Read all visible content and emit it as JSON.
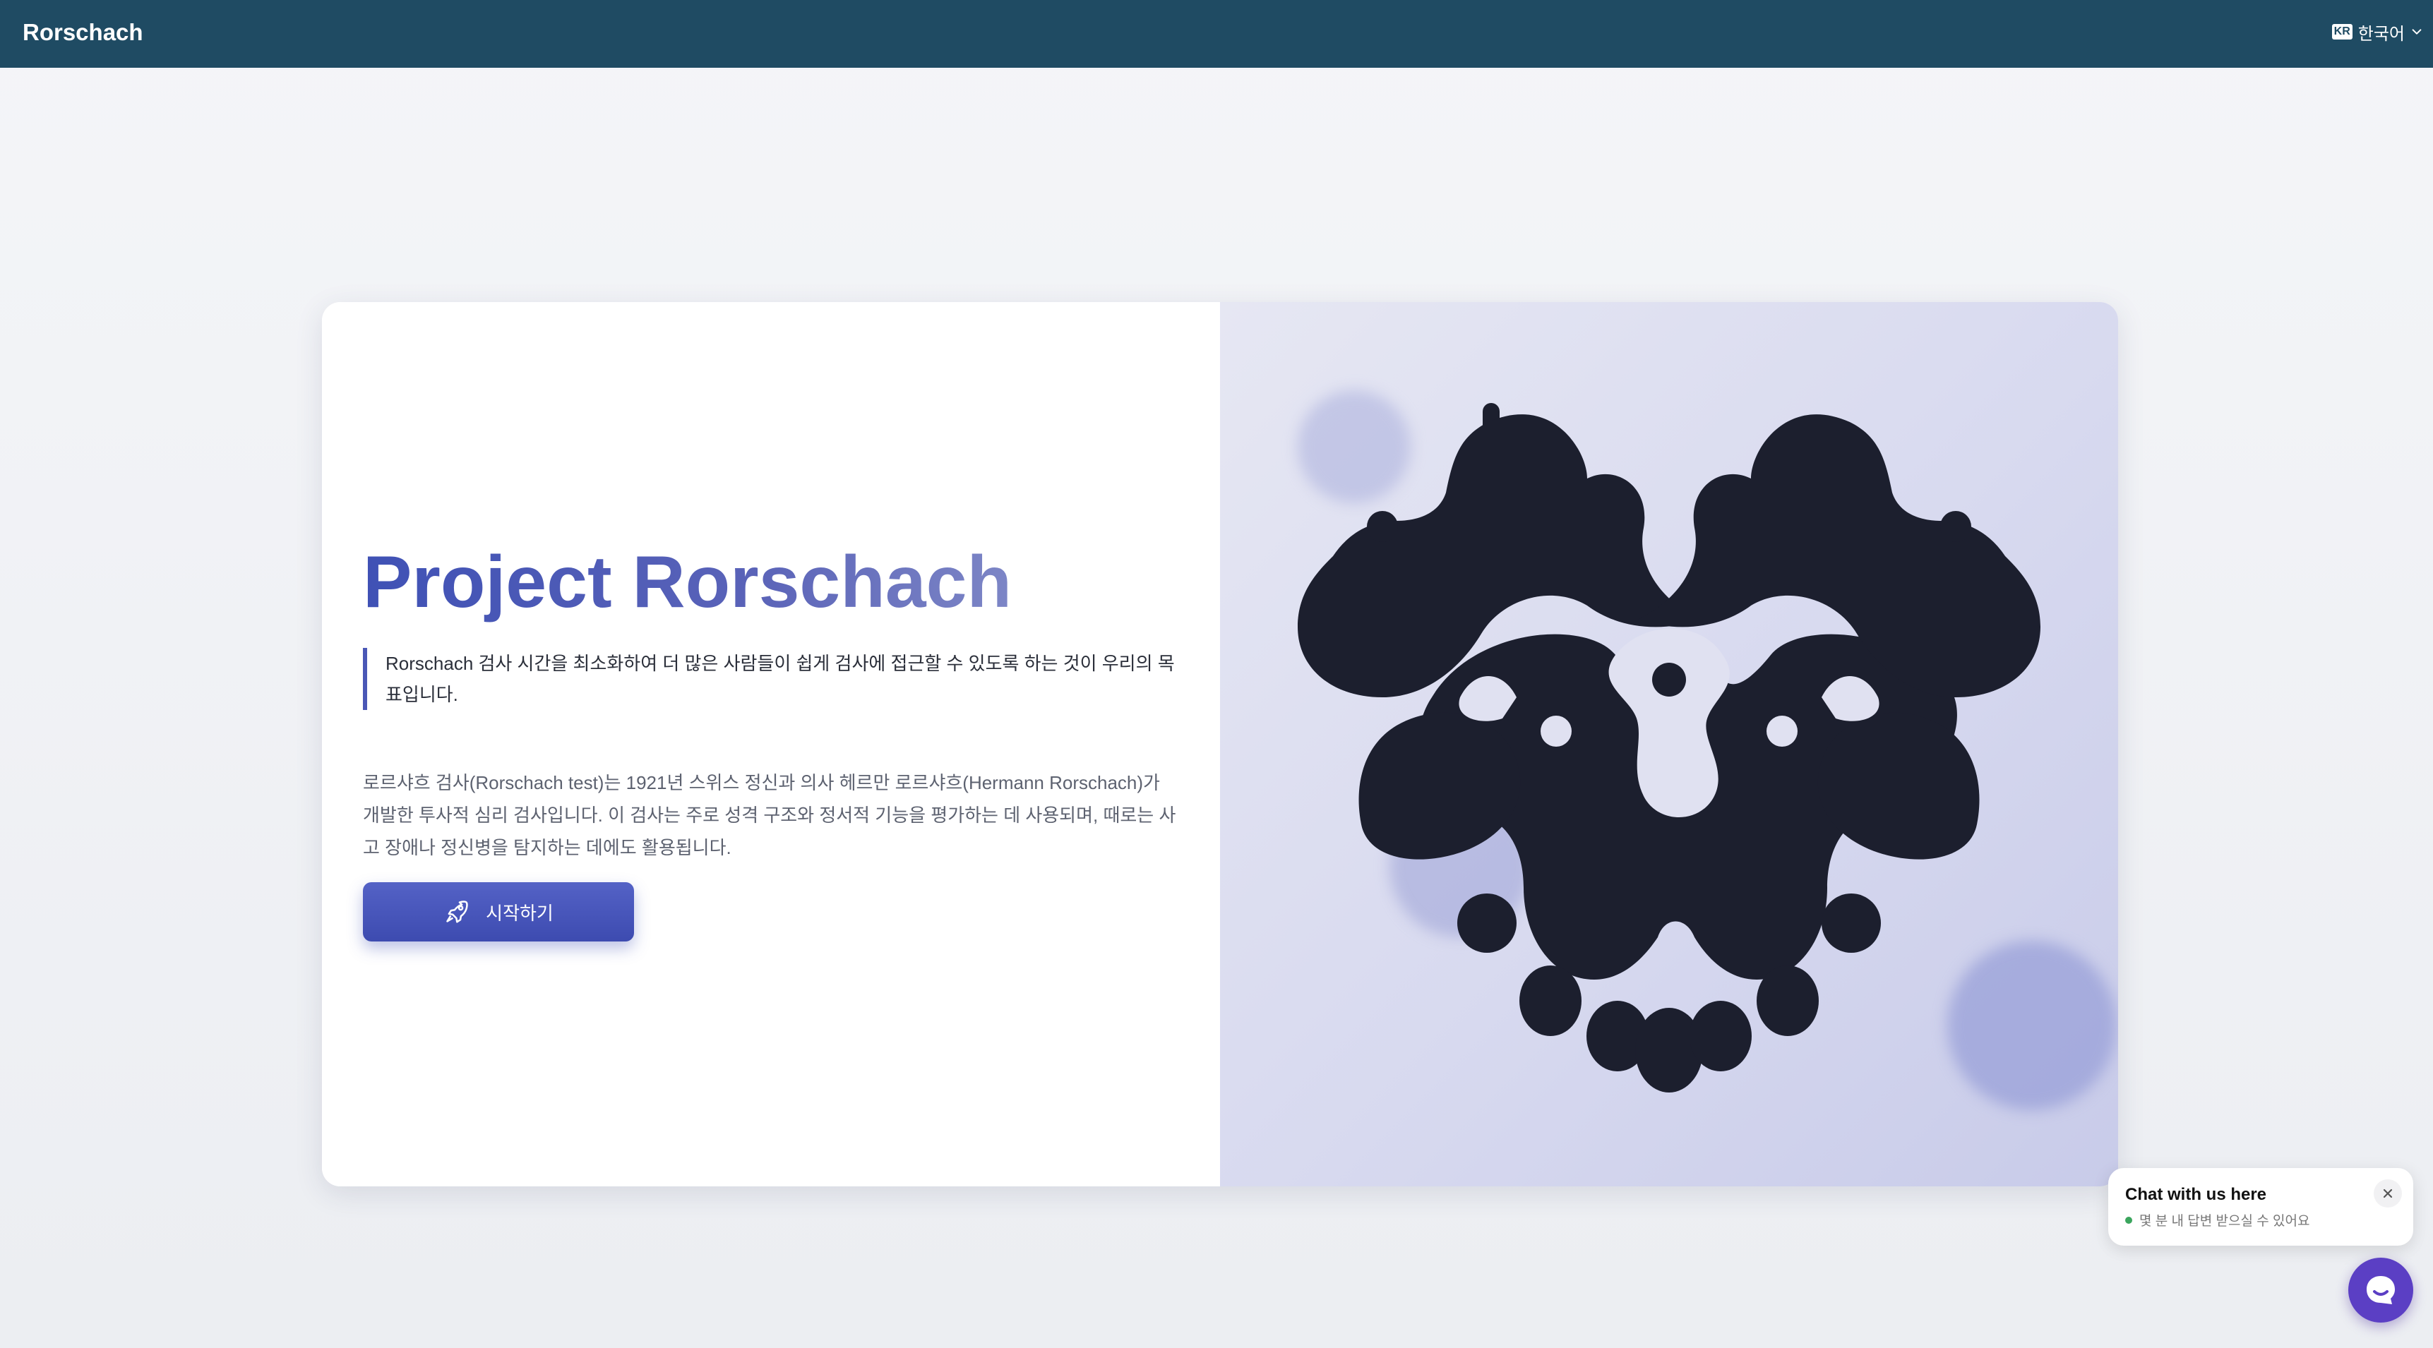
{
  "topbar": {
    "brand": "Rorschach",
    "language": {
      "flag": "KR",
      "label": "한국어"
    }
  },
  "hero": {
    "title": "Project Rorschach",
    "quote": "Rorschach 검사 시간을 최소화하여 더 많은 사람들이 쉽게 검사에 접근할 수 있도록 하는 것이 우리의 목표입니다.",
    "description": "로르샤흐 검사(Rorschach test)는 1921년 스위스 정신과 의사 헤르만 로르샤흐(Hermann Rorschach)가 개발한 투사적 심리 검사입니다. 이 검사는 주로 성격 구조와 정서적 기능을 평가하는 데 사용되며, 때로는 사고 장애나 정신병을 탐지하는 데에도 활용됩니다.",
    "start_button": "시작하기"
  },
  "chat": {
    "title": "Chat with us here",
    "subtitle": "몇 분 내 답변 받으실 수 있어요"
  },
  "colors": {
    "topbar": "#1f4b63",
    "accent": "#3f51b5",
    "ink": "#1c1f2e",
    "chat_launcher": "#5b3fc4",
    "online": "#3ba55d"
  },
  "icons": {
    "start_button": "rocket-icon",
    "language": "chevron-down-icon",
    "chat_close": "close-icon",
    "chat_launcher": "chat-bubble-icon"
  }
}
